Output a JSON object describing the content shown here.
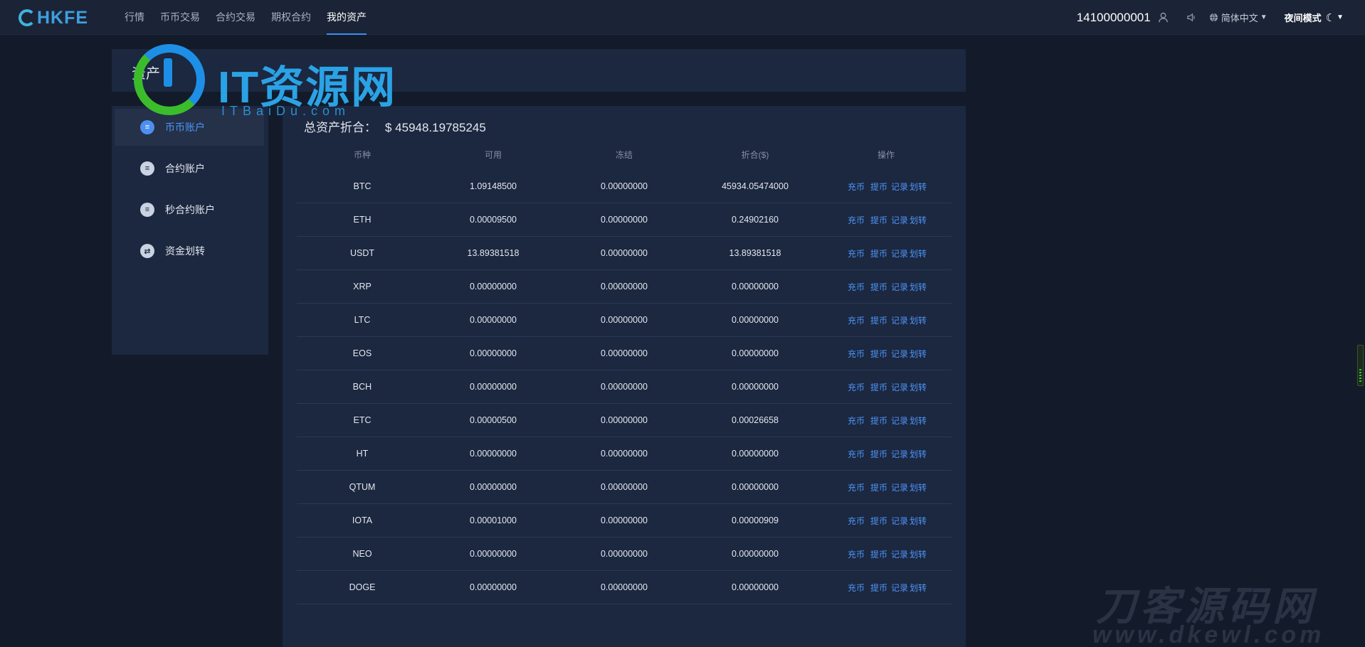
{
  "brand": {
    "name": "HKFE"
  },
  "nav": {
    "items": [
      {
        "label": "行情"
      },
      {
        "label": "币币交易"
      },
      {
        "label": "合约交易"
      },
      {
        "label": "期权合约"
      },
      {
        "label": "我的资产"
      }
    ],
    "active_index": 4
  },
  "header_right": {
    "user_id": "14100000001",
    "language": "简体中文",
    "night_mode": "夜间模式"
  },
  "asset": {
    "title": "资产"
  },
  "sidebar": {
    "items": [
      {
        "label": "币币账户",
        "icon": "wallet-icon",
        "active": true
      },
      {
        "label": "合约账户",
        "icon": "wallet-icon",
        "active": false
      },
      {
        "label": "秒合约账户",
        "icon": "wallet-icon",
        "active": false
      },
      {
        "label": "资金划转",
        "icon": "transfer-icon",
        "active": false
      }
    ]
  },
  "main": {
    "total_label": "总资产折合：",
    "total_value": "$ 45948.19785245",
    "columns": [
      "币种",
      "可用",
      "冻结",
      "折合($)",
      "操作"
    ],
    "actions": [
      "充币",
      "提币",
      "记录",
      "划转"
    ],
    "rows": [
      [
        "BTC",
        "1.09148500",
        "0.00000000",
        "45934.05474000"
      ],
      [
        "ETH",
        "0.00009500",
        "0.00000000",
        "0.24902160"
      ],
      [
        "USDT",
        "13.89381518",
        "0.00000000",
        "13.89381518"
      ],
      [
        "XRP",
        "0.00000000",
        "0.00000000",
        "0.00000000"
      ],
      [
        "LTC",
        "0.00000000",
        "0.00000000",
        "0.00000000"
      ],
      [
        "EOS",
        "0.00000000",
        "0.00000000",
        "0.00000000"
      ],
      [
        "BCH",
        "0.00000000",
        "0.00000000",
        "0.00000000"
      ],
      [
        "ETC",
        "0.00000500",
        "0.00000000",
        "0.00026658"
      ],
      [
        "HT",
        "0.00000000",
        "0.00000000",
        "0.00000000"
      ],
      [
        "QTUM",
        "0.00000000",
        "0.00000000",
        "0.00000000"
      ],
      [
        "IOTA",
        "0.00001000",
        "0.00000000",
        "0.00000909"
      ],
      [
        "NEO",
        "0.00000000",
        "0.00000000",
        "0.00000000"
      ],
      [
        "DOGE",
        "0.00000000",
        "0.00000000",
        "0.00000000"
      ]
    ]
  },
  "watermarks": {
    "top_text": "IT资源网",
    "top_sub": "ITBaiDu.com",
    "bottom_text": "刀客源码网",
    "bottom_sub": "www.dkewl.com"
  },
  "colors": {
    "accent": "#4d95f5",
    "background": "#131b2a",
    "panel": "#1c2740",
    "topbar": "#1b2436"
  }
}
